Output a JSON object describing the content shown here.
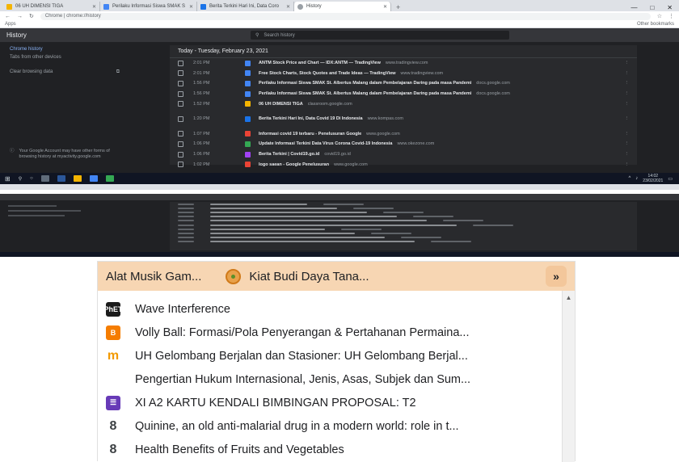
{
  "browser": {
    "tabs": [
      {
        "label": "06 UH DIMENSI TIGA",
        "color": "#f4b400"
      },
      {
        "label": "Perilaku Informasi Siswa SMAK S",
        "color": "#4285f4"
      },
      {
        "label": "Berita Terkini Hari Ini, Data Coro",
        "color": "#1a73e8"
      },
      {
        "label": "History",
        "color": "#9aa0a6"
      }
    ],
    "new_tab": "+",
    "window_controls": [
      "—",
      "□",
      "✕"
    ],
    "address": "Chrome | chrome://history",
    "bookmarks_apps": "Apps",
    "other_bookmarks": "Other bookmarks"
  },
  "history": {
    "title": "History",
    "search_placeholder": "Search history",
    "sidebar": {
      "items": [
        "Chrome history",
        "Tabs from other devices"
      ],
      "clear": "Clear browsing data",
      "account_note": "Your Google Account may have other forms of browsing history at myactivity.google.com"
    },
    "day_heading": "Today - Tuesday, February 23, 2021",
    "rows": [
      {
        "time": "2:01 PM",
        "title": "ANTM Stock Price and Chart — IDX:ANTM — TradingView",
        "domain": "www.tradingview.com",
        "color": "#4285f4"
      },
      {
        "time": "2:01 PM",
        "title": "Free Stock Charts, Stock Quotes and Trade Ideas — TradingView",
        "domain": "www.tradingview.com",
        "color": "#4285f4"
      },
      {
        "time": "1:56 PM",
        "title": "Perilaku Informasi Siswa SMAK St. Albertus Malang dalam Pembelajaran Daring pada masa Pandemi",
        "domain": "docs.google.com",
        "color": "#4285f4"
      },
      {
        "time": "1:56 PM",
        "title": "Perilaku Informasi Siswa SMAK St. Albertus Malang dalam Pembelajaran Daring pada masa Pandemi",
        "domain": "docs.google.com",
        "color": "#4285f4"
      },
      {
        "time": "1:52 PM",
        "title": "06 UH DIMENSI TIGA",
        "domain": "classroom.google.com",
        "color": "#f4b400"
      },
      {
        "time": "1:20 PM",
        "title": "Berita Terkini Hari Ini, Data Covid 19 Di Indonesia",
        "domain": "www.kompas.com",
        "color": "#1a73e8"
      },
      {
        "time": "1:07 PM",
        "title": "Informasi covid 19 terbaru - Penelusuran Google",
        "domain": "www.google.com",
        "color": "#ea4335"
      },
      {
        "time": "1:06 PM",
        "title": "Update Informasi Terkini Data Virus Corona Covid-19 Indonesia",
        "domain": "www.okezone.com",
        "color": "#34a853"
      },
      {
        "time": "1:06 PM",
        "title": "Berita Terkini | Covid19.go.id",
        "domain": "covid19.go.id",
        "color": "#a142f4"
      },
      {
        "time": "1:02 PM",
        "title": "logo saean - Google Penelusuran",
        "domain": "www.google.com",
        "color": "#ea4335"
      }
    ]
  },
  "taskbar": {
    "clock_time": "14:02",
    "clock_date": "23/02/2021"
  },
  "bookmark_menu": {
    "top_items": [
      "Alat Musik Gam...",
      "Kiat Budi Daya Tana..."
    ],
    "overflow": "»",
    "items": [
      {
        "label": "Wave Interference",
        "icon": "phet-icon",
        "icon_text": "PhET",
        "color": "#1b1b1b"
      },
      {
        "label": "Volly Ball: Formasi/Pola Penyerangan & Pertahanan Permaina...",
        "icon": "blogger-icon",
        "icon_text": "B",
        "color": "#f57d00"
      },
      {
        "label": "UH Gelombang Berjalan dan Stasioner: UH Gelombang Berjal...",
        "icon": "quizizz-icon",
        "icon_text": "m",
        "color": "#f29900"
      },
      {
        "label": "Pengertian Hukum Internasional, Jenis, Asas, Subjek dan Sum...",
        "icon": "blank-icon",
        "icon_text": "",
        "color": "transparent"
      },
      {
        "label": "XI A2 KARTU KENDALI BIMBINGAN PROPOSAL: T2",
        "icon": "forms-icon",
        "icon_text": "☰",
        "color": "#673ab7"
      },
      {
        "label": "Quinine, an old anti-malarial drug in a modern world: role in t...",
        "icon": "link-icon",
        "icon_text": "8",
        "color": "#3c4043"
      },
      {
        "label": "Health Benefits of Fruits and Vegetables",
        "icon": "link-icon",
        "icon_text": "8",
        "color": "#3c4043"
      }
    ]
  }
}
